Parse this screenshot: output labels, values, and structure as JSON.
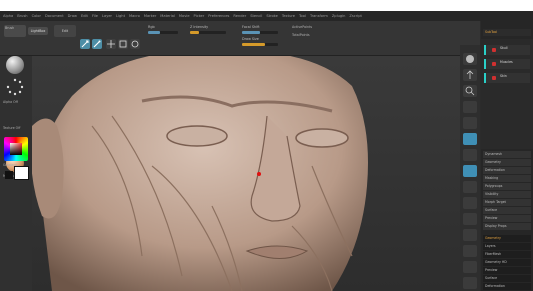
{
  "menu": [
    "Alpha",
    "Brush",
    "Color",
    "Document",
    "Draw",
    "Edit",
    "File",
    "Layer",
    "Light",
    "Macro",
    "Marker",
    "Material",
    "Movie",
    "Picker",
    "Preferences",
    "Render",
    "Stencil",
    "Stroke",
    "Texture",
    "Tool",
    "Transform",
    "Zplugin",
    "Zscript"
  ],
  "shelf": {
    "brush_label": "Brush",
    "lightbox_label": "LightBox",
    "mode_buttons": [
      "Edit",
      "Draw",
      "Move",
      "Scale",
      "Rotate"
    ],
    "focal_label": "Focal Shift",
    "draw_size_label": "Draw Size",
    "z_intensity_label": "Z Intensity",
    "rgb_label": "Rgb",
    "active_points_label": "ActivePoints",
    "total_points_label": "TotalPoints",
    "z_intensity_value": 25,
    "draw_size_value": 64,
    "focal_value": 0
  },
  "left_tray": {
    "alpha_label": "Alpha Off",
    "texture_label": "Texture Off",
    "material_label": "Material",
    "gradient_label": "Gradient"
  },
  "right_panel": {
    "subtool_label": "SubTool",
    "subtools": [
      "Skull",
      "Muscles",
      "Skin"
    ],
    "items": [
      "Dynamesh",
      "Geometry",
      "Deformation",
      "Masking",
      "Polygroups",
      "Visibility",
      "Morph Target",
      "Surface",
      "Preview",
      "Display Props"
    ],
    "lower_items": [
      "Geometry",
      "Layers",
      "FiberMesh",
      "Geometry HD",
      "Preview",
      "Surface",
      "Deformation"
    ]
  },
  "colors": {
    "accent_blue": "#4d8ea6",
    "slider_orange": "#d59a2a",
    "subtool_cyan": "#2ad0c8",
    "model_skin": "#b89a88"
  }
}
